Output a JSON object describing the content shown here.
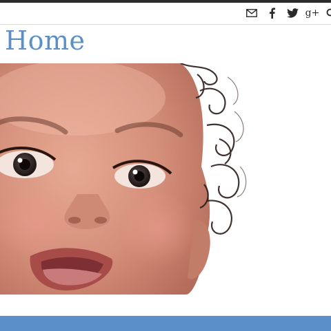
{
  "page": {
    "title": "Home"
  },
  "social": {
    "icons": [
      "mail-icon",
      "facebook-icon",
      "twitter-icon",
      "google-plus-icon",
      "search-icon"
    ],
    "google_plus_glyph": "g+"
  },
  "colors": {
    "top_strip": "#2b2b2b",
    "title": "#5a8fc8",
    "footer_band": "#5a8fc8",
    "icon": "#2a2a2a"
  }
}
